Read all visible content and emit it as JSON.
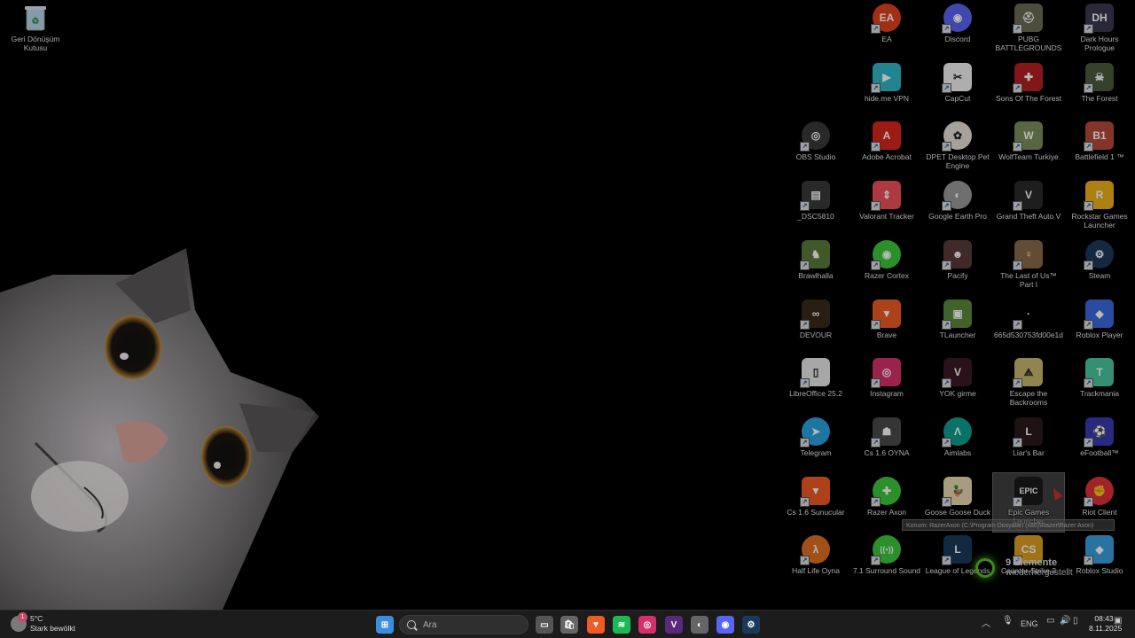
{
  "desktop": {
    "recycle_bin": "Geri Dönüşüm Kutusu",
    "icons": [
      {
        "label": "EA",
        "icon": "ea-icon",
        "color": "#e2401c",
        "text": "EA",
        "round": true
      },
      {
        "label": "Discord",
        "icon": "discord-icon",
        "color": "#5865f2",
        "text": "◉",
        "round": true
      },
      {
        "label": "PUBG BATTLEGROUNDS",
        "icon": "pubg-icon",
        "color": "#6b6b55",
        "text": "⛑"
      },
      {
        "label": "Dark Hours Prologue",
        "icon": "dark-hours-icon",
        "color": "#3c3850",
        "text": "DH"
      },
      {
        "label": "hide.me VPN",
        "icon": "hideme-vpn-icon",
        "color": "#2fb8c8",
        "text": "▶"
      },
      {
        "label": "CapCut",
        "icon": "capcut-icon",
        "color": "#f2f2f2",
        "text": "✂"
      },
      {
        "label": "Sons Of The Forest",
        "icon": "sons-of-the-forest-icon",
        "color": "#b32020",
        "text": "✚"
      },
      {
        "label": "The Forest",
        "icon": "the-forest-icon",
        "color": "#4a5a3a",
        "text": "☠"
      },
      {
        "label": "OBS Studio",
        "icon": "obs-studio-icon",
        "color": "#3a3a3a",
        "text": "◎",
        "round": true
      },
      {
        "label": "Adobe Acrobat",
        "icon": "adobe-acrobat-icon",
        "color": "#d8261c",
        "text": "A"
      },
      {
        "label": "DPET Desktop Pet Engine",
        "icon": "dpet-icon",
        "color": "#e8e0d8",
        "text": "✿",
        "round": true
      },
      {
        "label": "WolfTeam Turkiye",
        "icon": "wolfteam-icon",
        "color": "#7a8f5a",
        "text": "W"
      },
      {
        "label": "Battlefield 1 ™",
        "icon": "battlefield-icon",
        "color": "#b84a3a",
        "text": "B1"
      },
      {
        "label": "_DSC5810",
        "icon": "film-icon",
        "color": "#3a3a3a",
        "text": "▤"
      },
      {
        "label": "Valorant Tracker",
        "icon": "valorant-tracker-icon",
        "color": "#f0505a",
        "text": "⇕"
      },
      {
        "label": "Google Earth Pro",
        "icon": "google-earth-icon",
        "color": "#9a9a9a",
        "text": "◐",
        "round": true
      },
      {
        "label": "Grand Theft Auto V",
        "icon": "gta-v-icon",
        "color": "#2a2a2a",
        "text": "V"
      },
      {
        "label": "Rockstar Games Launcher",
        "icon": "rockstar-icon",
        "color": "#f2b21a",
        "text": "R"
      },
      {
        "label": "Brawlhalla",
        "icon": "brawlhalla-icon",
        "color": "#5a7a3a",
        "text": "♞"
      },
      {
        "label": "Razer Cortex",
        "icon": "razer-cortex-icon",
        "color": "#3cc83c",
        "text": "◉",
        "round": true
      },
      {
        "label": "Pacify",
        "icon": "pacify-icon",
        "color": "#5a3a3a",
        "text": "☻"
      },
      {
        "label": "The Last of Us™ Part I",
        "icon": "last-of-us-icon",
        "color": "#8a6a4a",
        "text": "♀"
      },
      {
        "label": "Steam",
        "icon": "steam-icon",
        "color": "#1b3a5a",
        "text": "⚙",
        "round": true
      },
      {
        "label": "DEVOUR",
        "icon": "devour-icon",
        "color": "#3a2a1a",
        "text": "∞"
      },
      {
        "label": "Brave",
        "icon": "brave-icon",
        "color": "#f05a24",
        "text": "▼"
      },
      {
        "label": "TLauncher",
        "icon": "tlauncher-icon",
        "color": "#5a8a3a",
        "text": "▣"
      },
      {
        "label": "665d530753fd00e1d...",
        "icon": "file-icon",
        "color": "#000000",
        "text": "·"
      },
      {
        "label": "Roblox Player",
        "icon": "roblox-player-icon",
        "color": "#3a6ae0",
        "text": "◆"
      },
      {
        "label": "LibreOffice 25.2",
        "icon": "libreoffice-icon",
        "color": "#e8e8e8",
        "text": "▯"
      },
      {
        "label": "Instagram",
        "icon": "instagram-icon",
        "color": "#d6306a",
        "text": "◎"
      },
      {
        "label": "YOK girme",
        "icon": "valorant-icon",
        "color": "#3a1a24",
        "text": "V"
      },
      {
        "label": "Escape the Backrooms",
        "icon": "escape-backrooms-icon",
        "color": "#c8b870",
        "text": "⟁"
      },
      {
        "label": "Trackmania",
        "icon": "trackmania-icon",
        "color": "#4ac8a0",
        "text": "T"
      },
      {
        "label": "Telegram",
        "icon": "telegram-icon",
        "color": "#2aa3e0",
        "text": "➤",
        "round": true
      },
      {
        "label": "Cs 1.6 OYNA",
        "icon": "cs-icon",
        "color": "#4a4a4a",
        "text": "☗"
      },
      {
        "label": "Aimlabs",
        "icon": "aimlabs-icon",
        "color": "#0fa090",
        "text": "Λ",
        "round": true
      },
      {
        "label": "Liar's Bar",
        "icon": "liars-bar-icon",
        "color": "#2a1a1a",
        "text": "L"
      },
      {
        "label": "eFootball™",
        "icon": "efootball-icon",
        "color": "#3a3ab0",
        "text": "⚽"
      },
      {
        "label": "Cs 1.6 Sunucular",
        "icon": "cs-server-icon",
        "color": "#f05a24",
        "text": "▼"
      },
      {
        "label": "Razer Axon",
        "icon": "razer-axon-icon",
        "color": "#3cc83c",
        "text": "✚",
        "round": true
      },
      {
        "label": "Goose Goose Duck",
        "icon": "goose-goose-duck-icon",
        "color": "#e8d8b0",
        "text": "🦆"
      },
      {
        "label": "Epic Games Launcher",
        "icon": "epic-games-icon",
        "color": "#1a1a1a",
        "text": "EPIC"
      },
      {
        "label": "Riot Client",
        "icon": "riot-client-icon",
        "color": "#e0303a",
        "text": "✊",
        "round": true
      },
      {
        "label": "Half Life Oyna",
        "icon": "half-life-icon",
        "color": "#e07020",
        "text": "λ",
        "round": true
      },
      {
        "label": "7.1 Surround Sound",
        "icon": "surround-sound-icon",
        "color": "#3cc83c",
        "text": "((•))",
        "round": true
      },
      {
        "label": "League of Legends",
        "icon": "league-of-legends-icon",
        "color": "#1a3a5a",
        "text": "L"
      },
      {
        "label": "Counter-Strike 2",
        "icon": "counter-strike-2-icon",
        "color": "#e0a020",
        "text": "CS"
      },
      {
        "label": "Roblox Studio",
        "icon": "roblox-studio-icon",
        "color": "#3aa0e0",
        "text": "◆"
      }
    ],
    "tooltip": "Konum: RazerAxon (C:\\Program Dosyaları (x86)\\Razer\\Razer Axon)",
    "notification": {
      "count": "9 Elemente",
      "text": "wiederhergestellt"
    }
  },
  "taskbar": {
    "weather": {
      "badge": "1",
      "temp": "5°C",
      "desc": "Stark bewölkt"
    },
    "search_placeholder": "Ara",
    "apps": [
      {
        "icon": "windows-start-icon",
        "color": "#3a8ee0",
        "text": "⊞"
      },
      {
        "icon": "task-view-icon",
        "color": "#555555",
        "text": "▭"
      },
      {
        "icon": "microsoft-store-icon",
        "color": "#666666",
        "text": "🛍"
      },
      {
        "icon": "brave-taskbar-icon",
        "color": "#f05a24",
        "text": "▼"
      },
      {
        "icon": "spotify-icon",
        "color": "#1db954",
        "text": "≋"
      },
      {
        "icon": "instagram-taskbar-icon",
        "color": "#d6306a",
        "text": "◎"
      },
      {
        "icon": "visual-studio-icon",
        "color": "#5a2a7a",
        "text": "V"
      },
      {
        "icon": "dpet-taskbar-icon",
        "color": "#666666",
        "text": "◐"
      },
      {
        "icon": "discord-taskbar-icon",
        "color": "#5865f2",
        "text": "◉"
      },
      {
        "icon": "steam-taskbar-icon",
        "color": "#1b3a5a",
        "text": "⚙"
      }
    ],
    "lang": "ENG",
    "time": "08:43",
    "date": "8.11.2025"
  }
}
